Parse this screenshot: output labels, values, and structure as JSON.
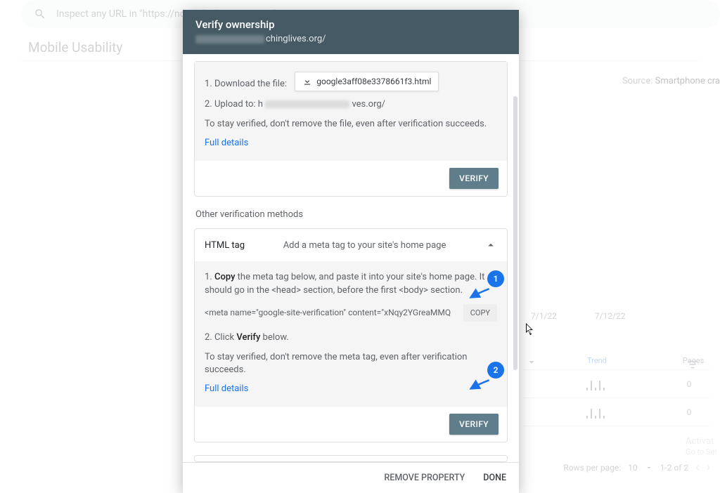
{
  "search": {
    "placeholder": "Inspect any URL in \"https://ndmediadesigns.com/\""
  },
  "page": {
    "title": "Mobile Usability",
    "source_label": "Source:",
    "source_value": "Smartphone cra"
  },
  "dates": [
    "7/1/22",
    "7/12/22"
  ],
  "table": {
    "trend": "Trend",
    "pages": "Pages",
    "rows": [
      {
        "pages": "0"
      },
      {
        "pages": "0"
      }
    ]
  },
  "pager": {
    "rpp_label": "Rows per page:",
    "rpp_value": "10",
    "range": "1-2 of 2"
  },
  "watermark": {
    "line1": "Activat",
    "line2": "Go to Set"
  },
  "dialog": {
    "title": "Verify ownership",
    "domain_suffix": "chinglives.org/",
    "method1": {
      "step1_label": "1. Download the file:",
      "file_name": "google3aff08e3378661f3.html",
      "step2_prefix": "2. Upload to: h",
      "step2_suffix": "ves.org/",
      "note": "To stay verified, don't remove the file, even after verification succeeds.",
      "full_details": "Full details",
      "verify": "VERIFY"
    },
    "other_label": "Other verification methods",
    "method2": {
      "acc_title": "HTML tag",
      "acc_desc": "Add a meta tag to your site's home page",
      "step1_a": "1. ",
      "step1_b": "Copy",
      "step1_c": " the meta tag below, and paste it into your site's home page. It should go in the <head> section, before the first <body> section.",
      "meta_code": "<meta name=\"google-site-verification\" content=\"xNqy2YGreaMMQ",
      "copy": "COPY",
      "step2_a": "2. Click ",
      "step2_b": "Verify",
      "step2_c": " below.",
      "note": "To stay verified, don't remove the meta tag, even after verification succeeds.",
      "full_details": "Full details",
      "verify": "VERIFY"
    },
    "footer": {
      "remove": "REMOVE PROPERTY",
      "done": "DONE"
    }
  },
  "callouts": {
    "c1": "1",
    "c2": "2"
  }
}
